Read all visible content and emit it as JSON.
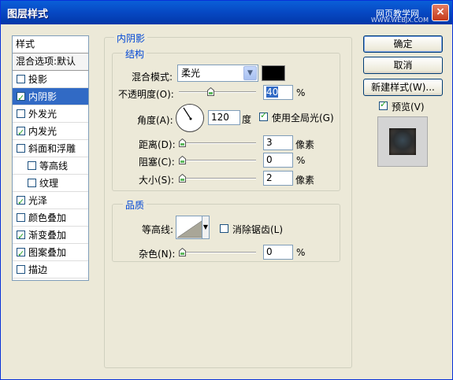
{
  "window": {
    "title": "图层样式",
    "watermark": "网页教学网",
    "watermark_url": "WWW.WEBJX.COM",
    "close_glyph": "×"
  },
  "styles_panel": {
    "header": "样式",
    "blend_options": "混合选项:默认",
    "items": [
      {
        "label": "投影",
        "checked": false,
        "selected": false,
        "sub": false
      },
      {
        "label": "内阴影",
        "checked": true,
        "selected": true,
        "sub": false
      },
      {
        "label": "外发光",
        "checked": false,
        "selected": false,
        "sub": false
      },
      {
        "label": "内发光",
        "checked": true,
        "selected": false,
        "sub": false
      },
      {
        "label": "斜面和浮雕",
        "checked": false,
        "selected": false,
        "sub": false
      },
      {
        "label": "等高线",
        "checked": false,
        "selected": false,
        "sub": true
      },
      {
        "label": "纹理",
        "checked": false,
        "selected": false,
        "sub": true
      },
      {
        "label": "光泽",
        "checked": true,
        "selected": false,
        "sub": false
      },
      {
        "label": "颜色叠加",
        "checked": false,
        "selected": false,
        "sub": false
      },
      {
        "label": "渐变叠加",
        "checked": true,
        "selected": false,
        "sub": false
      },
      {
        "label": "图案叠加",
        "checked": true,
        "selected": false,
        "sub": false
      },
      {
        "label": "描边",
        "checked": false,
        "selected": false,
        "sub": false
      }
    ]
  },
  "inner_shadow": {
    "group_title": "内阴影",
    "structure": {
      "title": "结构",
      "blend_mode_label": "混合模式:",
      "blend_mode_value": "柔光",
      "color": "#000000",
      "opacity_label": "不透明度(O):",
      "opacity_value": "40",
      "opacity_unit": "%",
      "opacity_level": 0.4,
      "angle_label": "角度(A):",
      "angle_value": "120",
      "angle_unit": "度",
      "global_light_label": "使用全局光(G)",
      "global_light_checked": true,
      "distance_label": "距离(D):",
      "distance_value": "3",
      "distance_unit": "像素",
      "choke_label": "阻塞(C):",
      "choke_value": "0",
      "choke_unit": "%",
      "size_label": "大小(S):",
      "size_value": "2",
      "size_unit": "像素"
    },
    "quality": {
      "title": "品质",
      "contour_label": "等高线:",
      "antialias_label": "消除锯齿(L)",
      "antialias_checked": false,
      "noise_label": "杂色(N):",
      "noise_value": "0",
      "noise_unit": "%"
    }
  },
  "buttons": {
    "ok": "确定",
    "cancel": "取消",
    "new_style": "新建样式(W)...",
    "preview_label": "预览(V)",
    "preview_checked": true
  },
  "colors": {
    "selection": "#316ac5",
    "group_title": "#0046d5",
    "titlebar": "#0a5fd8"
  }
}
